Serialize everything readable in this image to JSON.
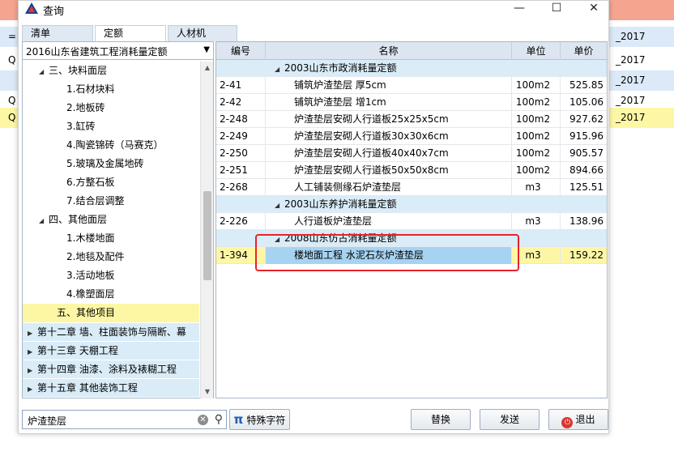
{
  "window": {
    "title": "查询",
    "min": "—",
    "max": "☐",
    "close": "✕"
  },
  "background": {
    "right_rows": [
      {
        "text": "",
        "color": "#f4a48f"
      },
      {
        "text": "_2017",
        "color": "#dbe9f8"
      },
      {
        "text": "_2017",
        "color": "#ffffff"
      },
      {
        "text": "_2017",
        "color": "#dbe9f8"
      },
      {
        "text": "_2017",
        "color": "#ffffff"
      },
      {
        "text": "_2017",
        "color": "#fdf7a5"
      }
    ],
    "left_rows": [
      {
        "text": "",
        "color": "#f4a48f"
      },
      {
        "text": "=",
        "color": "#dbe9f8"
      },
      {
        "text": "Q",
        "color": "#ffffff"
      },
      {
        "text": "",
        "color": "#dbe9f8"
      },
      {
        "text": "Q",
        "color": "#ffffff"
      },
      {
        "text": "Q",
        "color": "#fdf7a5"
      }
    ]
  },
  "tabs": [
    "清单",
    "定额",
    "人材机"
  ],
  "combo": {
    "value": "2016山东省建筑工程消耗量定额"
  },
  "tree": [
    {
      "label": "三、块料面层",
      "indent": 34,
      "arrow": "◢",
      "type": "normal"
    },
    {
      "label": "1.石材块料",
      "indent": 54,
      "arrow": "",
      "type": "normal"
    },
    {
      "label": "2.地板砖",
      "indent": 54,
      "arrow": "",
      "type": "normal"
    },
    {
      "label": "3.缸砖",
      "indent": 54,
      "arrow": "",
      "type": "normal"
    },
    {
      "label": "4.陶瓷锦砖（马赛克）",
      "indent": 54,
      "arrow": "",
      "type": "normal"
    },
    {
      "label": "5.玻璃及金属地砖",
      "indent": 54,
      "arrow": "",
      "type": "normal"
    },
    {
      "label": "6.方整石板",
      "indent": 54,
      "arrow": "",
      "type": "normal"
    },
    {
      "label": "7.结合层调整",
      "indent": 54,
      "arrow": "",
      "type": "normal"
    },
    {
      "label": "四、其他面层",
      "indent": 34,
      "arrow": "◢",
      "type": "normal"
    },
    {
      "label": "1.木楼地面",
      "indent": 54,
      "arrow": "",
      "type": "normal"
    },
    {
      "label": "2.地毯及配件",
      "indent": 54,
      "arrow": "",
      "type": "normal"
    },
    {
      "label": "3.活动地板",
      "indent": 54,
      "arrow": "",
      "type": "normal"
    },
    {
      "label": "4.橡塑面层",
      "indent": 54,
      "arrow": "",
      "type": "normal"
    },
    {
      "label": "五、其他项目",
      "indent": 42,
      "arrow": "",
      "type": "highlight"
    },
    {
      "label": "第十二章 墙、柱面装饰与隔断、幕",
      "indent": 20,
      "arrow": "▶",
      "type": "chapter"
    },
    {
      "label": "第十三章 天棚工程",
      "indent": 20,
      "arrow": "▶",
      "type": "chapter"
    },
    {
      "label": "第十四章 油漆、涂料及裱糊工程",
      "indent": 20,
      "arrow": "▶",
      "type": "chapter"
    },
    {
      "label": "第十五章 其他装饰工程",
      "indent": 20,
      "arrow": "▶",
      "type": "chapter"
    }
  ],
  "table": {
    "headers": [
      "编号",
      "名称",
      "单位",
      "单价"
    ],
    "rows": [
      {
        "type": "group",
        "name": "2003山东市政消耗量定额"
      },
      {
        "type": "data",
        "code": "2-41",
        "name": "铺筑炉渣垫层 厚5cm",
        "unit": "100m2",
        "price": "525.85"
      },
      {
        "type": "data",
        "code": "2-42",
        "name": "铺筑炉渣垫层 增1cm",
        "unit": "100m2",
        "price": "105.06"
      },
      {
        "type": "data",
        "code": "2-248",
        "name": "炉渣垫层安砌人行道板25x25x5cm",
        "unit": "100m2",
        "price": "927.62"
      },
      {
        "type": "data",
        "code": "2-249",
        "name": "炉渣垫层安砌人行道板30x30x6cm",
        "unit": "100m2",
        "price": "915.96"
      },
      {
        "type": "data",
        "code": "2-250",
        "name": "炉渣垫层安砌人行道板40x40x7cm",
        "unit": "100m2",
        "price": "905.57"
      },
      {
        "type": "data",
        "code": "2-251",
        "name": "炉渣垫层安砌人行道板50x50x8cm",
        "unit": "100m2",
        "price": "894.66"
      },
      {
        "type": "data",
        "code": "2-268",
        "name": "人工铺装侧缘石炉渣垫层",
        "unit": "m3",
        "price": "125.51"
      },
      {
        "type": "group",
        "name": "2003山东养护消耗量定额"
      },
      {
        "type": "data",
        "code": "2-226",
        "name": "人行道板炉渣垫层",
        "unit": "m3",
        "price": "138.96"
      },
      {
        "type": "group",
        "name": "2008山东仿古消耗量定额"
      },
      {
        "type": "selected",
        "code": "1-394",
        "name": "楼地面工程 水泥石灰炉渣垫层",
        "unit": "m3",
        "price": "159.22"
      }
    ]
  },
  "search": {
    "value": "炉渣垫层"
  },
  "buttons": {
    "special_chars": "特殊字符",
    "replace": "替换",
    "send": "发送",
    "exit": "退出"
  },
  "colors": {
    "highlight": "#e8232a",
    "selection": "#a7d3f2",
    "yellow": "#fdf7a5",
    "group": "#d9ecf8"
  }
}
